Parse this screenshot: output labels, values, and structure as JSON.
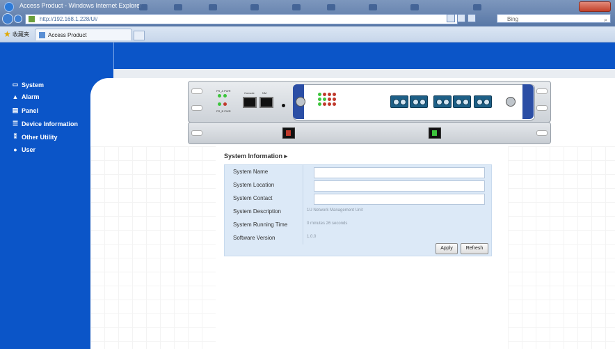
{
  "browser": {
    "title": "Access Product - Windows Internet Explorer",
    "address": "http://192.168.1.228/Ui/",
    "search_placeholder": "Bing",
    "favorites_label": "收藏夹",
    "tab_label": "Access Product"
  },
  "sidebar": {
    "items": [
      {
        "label": "System",
        "icon": "monitor-icon"
      },
      {
        "label": "Alarm",
        "icon": "warning-icon"
      },
      {
        "label": "Panel",
        "icon": "panel-icon"
      },
      {
        "label": "Device Information",
        "icon": "list-icon"
      },
      {
        "label": "Other Utility",
        "icon": "tools-icon"
      },
      {
        "label": "User",
        "icon": "user-icon"
      }
    ]
  },
  "device": {
    "led_labels": [
      "PS_A PWR",
      "PS_B PWR"
    ],
    "port_labels": [
      "Console",
      "NM"
    ]
  },
  "system_info": {
    "title": "System Information ▸",
    "rows": [
      {
        "label": "System Name",
        "value": ""
      },
      {
        "label": "System Location",
        "value": ""
      },
      {
        "label": "System Contact",
        "value": ""
      },
      {
        "label": "System Description",
        "value": "1U Network Management Unit"
      },
      {
        "label": "System Running Time",
        "value": "0 minutes 26 seconds"
      },
      {
        "label": "Software Version",
        "value": "1.0.0"
      }
    ],
    "apply_label": "Apply",
    "refresh_label": "Refresh"
  },
  "colors": {
    "nav_blue": "#0b55c8",
    "form_bg": "#dce9f7",
    "led_green": "#3cc43c",
    "led_red": "#c0392b"
  }
}
